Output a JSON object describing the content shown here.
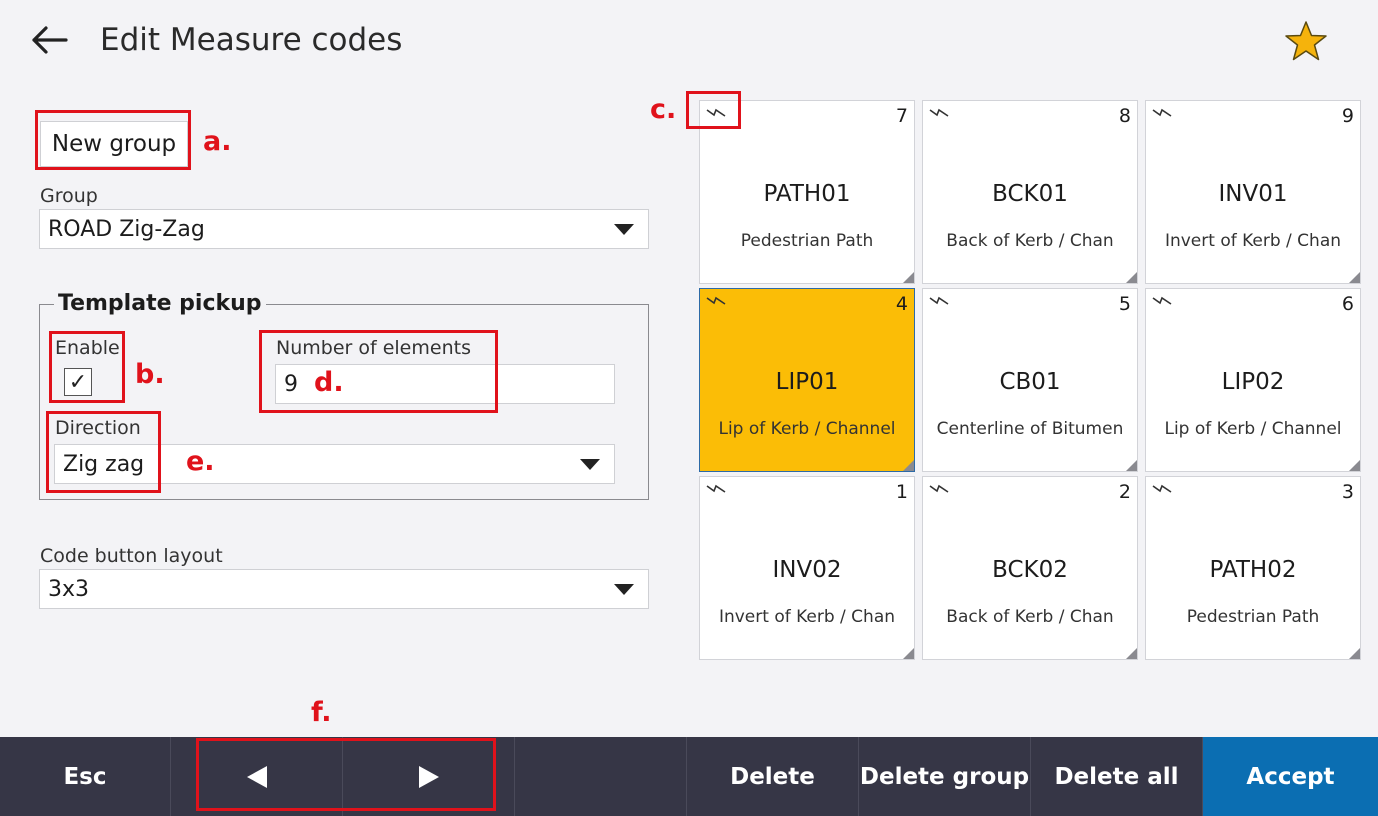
{
  "header": {
    "title": "Edit Measure codes"
  },
  "buttons": {
    "new_group": "New group"
  },
  "group": {
    "label": "Group",
    "value": "ROAD Zig-Zag"
  },
  "template_pickup": {
    "legend": "Template pickup",
    "enable_label": "Enable",
    "enable_checked": true,
    "checkmark": "✓",
    "elements_label": "Number of elements",
    "elements_value": "9",
    "direction_label": "Direction",
    "direction_value": "Zig zag"
  },
  "layout": {
    "label": "Code button layout",
    "value": "3x3"
  },
  "annotations": {
    "a": "a.",
    "b": "b.",
    "c": "c.",
    "d": "d.",
    "e": "e.",
    "f": "f."
  },
  "tiles": [
    {
      "num": "7",
      "code": "PATH01",
      "desc": "Pedestrian Path",
      "selected": false
    },
    {
      "num": "8",
      "code": "BCK01",
      "desc": "Back of Kerb / Chan",
      "selected": false
    },
    {
      "num": "9",
      "code": "INV01",
      "desc": "Invert of Kerb / Chan",
      "selected": false
    },
    {
      "num": "4",
      "code": "LIP01",
      "desc": "Lip of Kerb / Channel",
      "selected": true
    },
    {
      "num": "5",
      "code": "CB01",
      "desc": "Centerline of Bitumen",
      "selected": false
    },
    {
      "num": "6",
      "code": "LIP02",
      "desc": "Lip of Kerb / Channel",
      "selected": false
    },
    {
      "num": "1",
      "code": "INV02",
      "desc": "Invert of Kerb / Chan",
      "selected": false
    },
    {
      "num": "2",
      "code": "BCK02",
      "desc": "Back of Kerb / Chan",
      "selected": false
    },
    {
      "num": "3",
      "code": "PATH02",
      "desc": "Pedestrian Path",
      "selected": false
    }
  ],
  "bottombar": {
    "esc": "Esc",
    "delete": "Delete",
    "delete_group": "Delete group",
    "delete_all": "Delete all",
    "accept": "Accept"
  },
  "colors": {
    "selected_tile": "#fbbd06",
    "accept": "#0b6eb2",
    "bar": "#363646",
    "annotation": "#e0121b",
    "star": "#f5b30c"
  }
}
